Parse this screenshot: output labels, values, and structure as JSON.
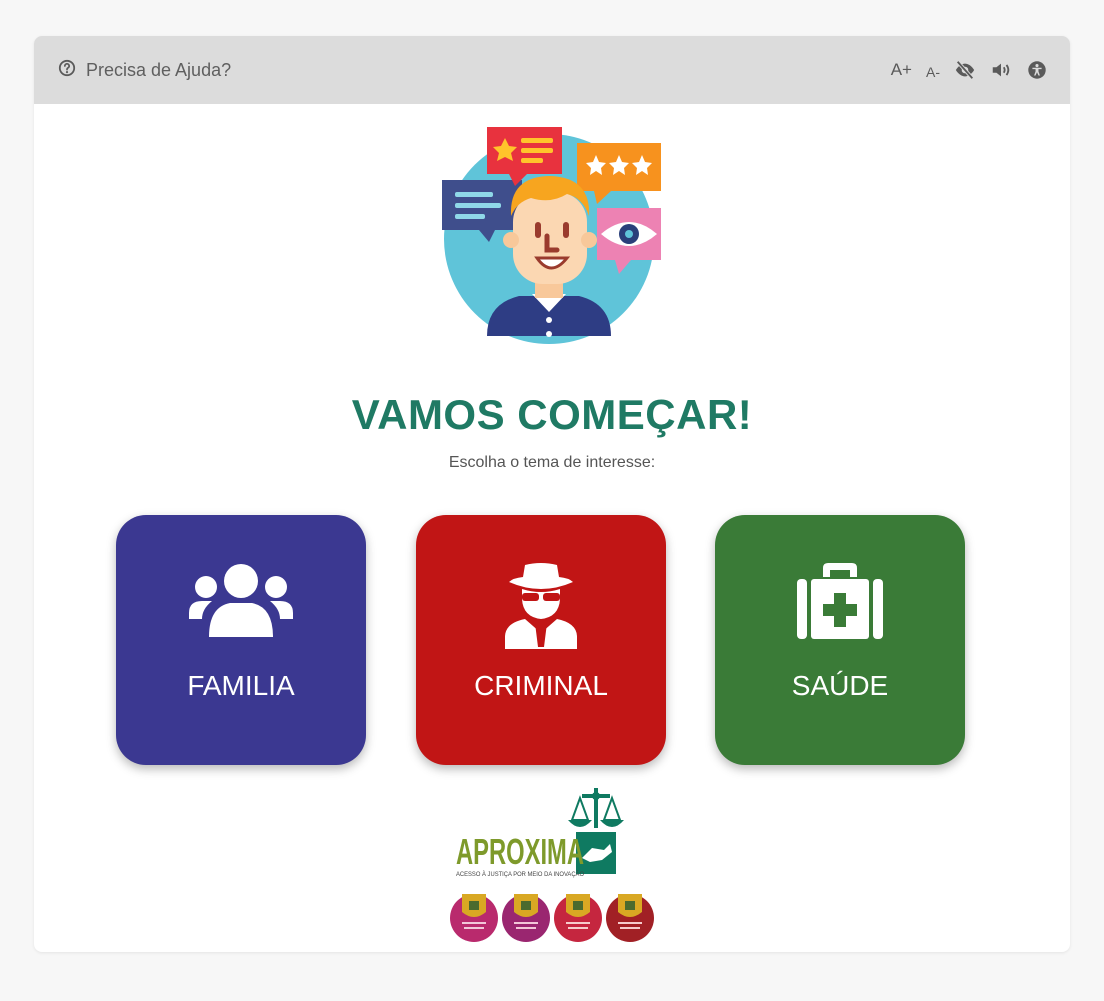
{
  "header": {
    "help_label": "Precisa de Ajuda?",
    "font_increase": "A+",
    "font_decrease": "A-",
    "icons": [
      "help-circle-icon",
      "contrast-eye-icon",
      "audio-speaker-icon",
      "accessibility-icon"
    ]
  },
  "main": {
    "title": "VAMOS COMEÇAR!",
    "subtitle": "Escolha o tema de interesse:"
  },
  "topics": [
    {
      "label": "FAMILIA",
      "color": "#3b3891",
      "icon": "family-users-icon"
    },
    {
      "label": "CRIMINAL",
      "color": "#c11515",
      "icon": "spy-detective-icon"
    },
    {
      "label": "SAÚDE",
      "color": "#3a7b37",
      "icon": "medical-kit-icon"
    }
  ],
  "footer": {
    "logo_text": "APROXIMA",
    "logo_tagline": "ACESSO À JUSTIÇA POR MEIO DA INOVAÇÃO",
    "badge_count": 4
  },
  "colors": {
    "title": "#1f7a64",
    "topbar": "#dcdcdc",
    "logo_green": "#7e9a2b",
    "logo_teal": "#0f7a61"
  }
}
